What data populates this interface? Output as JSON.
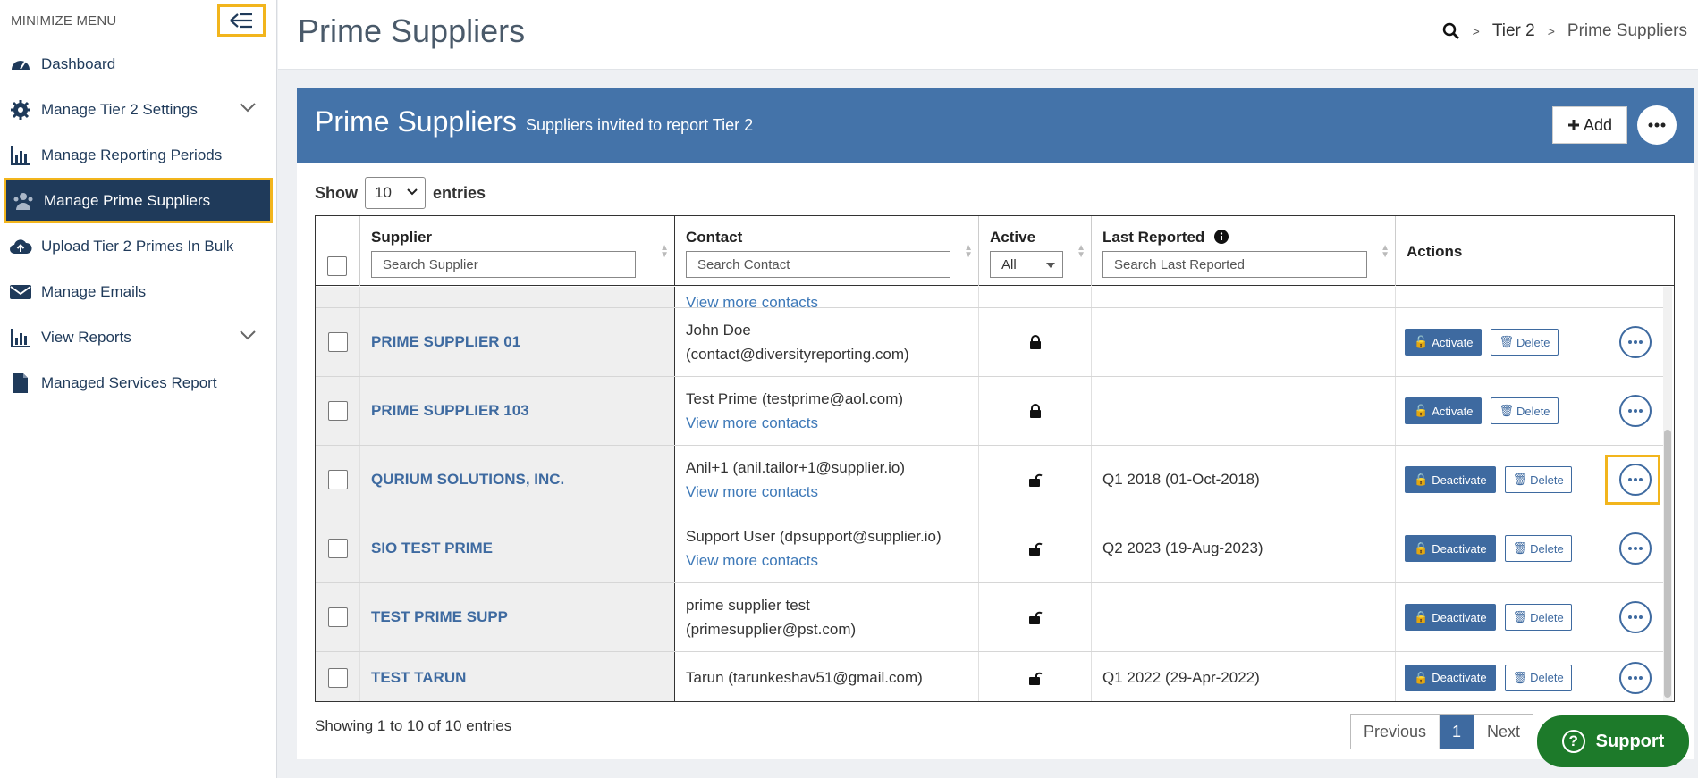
{
  "sidebar": {
    "minimize_label": "MINIMIZE MENU",
    "items": [
      {
        "label": "Dashboard",
        "icon": "gauge-icon"
      },
      {
        "label": "Manage Tier 2 Settings",
        "icon": "gear-icon"
      },
      {
        "label": "Manage Reporting Periods",
        "icon": "bar-chart-icon"
      },
      {
        "label": "Manage Prime Suppliers",
        "icon": "people-icon"
      },
      {
        "label": "Upload Tier 2 Primes In Bulk",
        "icon": "cloud-upload-icon"
      },
      {
        "label": "Manage Emails",
        "icon": "envelope-icon"
      },
      {
        "label": "View Reports",
        "icon": "bar-chart-icon"
      },
      {
        "label": "Managed Services Report",
        "icon": "file-icon"
      }
    ]
  },
  "header": {
    "title": "Prime Suppliers",
    "breadcrumb": [
      "Tier 2",
      "Prime Suppliers"
    ]
  },
  "panel": {
    "title": "Prime Suppliers",
    "subtitle": "Suppliers invited to report Tier 2",
    "add_label": "Add"
  },
  "show": {
    "label_before": "Show",
    "value": "10",
    "label_after": "entries"
  },
  "columns": {
    "supplier": "Supplier",
    "supplier_placeholder": "Search Supplier",
    "contact": "Contact",
    "contact_placeholder": "Search Contact",
    "active": "Active",
    "active_value": "All",
    "last_reported": "Last Reported",
    "last_placeholder": "Search Last Reported",
    "actions": "Actions"
  },
  "partial_row_link": "View more contacts",
  "rows": [
    {
      "supplier": "PRIME SUPPLIER 01",
      "contact1": "John Doe",
      "contact2": "(contact@diversityreporting.com)",
      "last": "",
      "action": "Activate",
      "delete": "Delete"
    },
    {
      "supplier": "PRIME SUPPLIER 103",
      "contact1": "Test Prime (testprime@aol.com)",
      "contact2": "View more contacts",
      "last": "",
      "action": "Activate",
      "delete": "Delete"
    },
    {
      "supplier": "QURIUM SOLUTIONS, INC.",
      "contact1": "Anil+1 (anil.tailor+1@supplier.io)",
      "contact2": "View more contacts",
      "last": "Q1 2018 (01-Oct-2018)",
      "action": "Deactivate",
      "delete": "Delete"
    },
    {
      "supplier": "SIO TEST PRIME",
      "contact1": "Support User (dpsupport@supplier.io)",
      "contact2": "View more contacts",
      "last": "Q2 2023 (19-Aug-2023)",
      "action": "Deactivate",
      "delete": "Delete"
    },
    {
      "supplier": "TEST PRIME SUPP",
      "contact1": "prime supplier test",
      "contact2": "(primesupplier@pst.com)",
      "last": "",
      "action": "Deactivate",
      "delete": "Delete"
    },
    {
      "supplier": "TEST TARUN",
      "contact1": "Tarun (tarunkeshav51@gmail.com)",
      "contact2": "",
      "last": "Q1 2022 (29-Apr-2022)",
      "action": "Deactivate",
      "delete": "Delete"
    }
  ],
  "footer": {
    "info": "Showing 1 to 10 of 10 entries",
    "prev": "Previous",
    "page": "1",
    "next": "Next"
  },
  "support_label": "Support",
  "colors": {
    "brand_blue": "#4473a9",
    "nav_active": "#1f3a5a",
    "highlight": "#f2b51d",
    "support_green": "#1d7a2a"
  }
}
